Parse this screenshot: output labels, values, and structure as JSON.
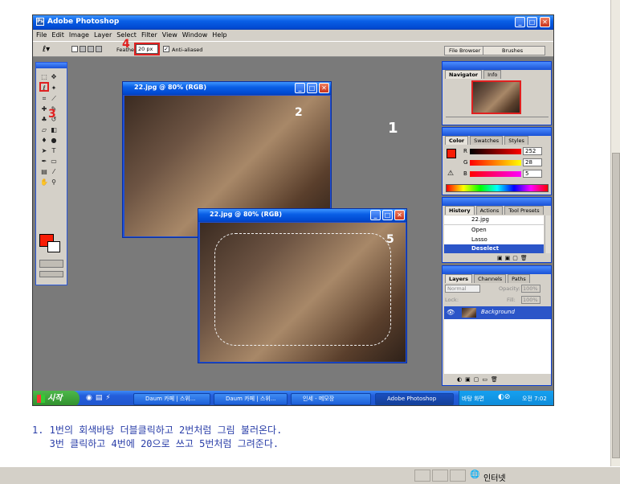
{
  "app": {
    "title": "Adobe Photoshop",
    "menu": [
      "File",
      "Edit",
      "Image",
      "Layer",
      "Select",
      "Filter",
      "View",
      "Window",
      "Help"
    ]
  },
  "options": {
    "feather_label": "Feather:",
    "feather_value": "20 px",
    "antialias_label": "Anti-aliased",
    "antialias_checked": true,
    "well_tabs": [
      "File Browser",
      "Brushes"
    ]
  },
  "annotations": {
    "a1": "1",
    "a2": "2",
    "a3": "3",
    "a4": "4",
    "a5": "5",
    "color": "#e02020"
  },
  "doc1": {
    "title": "22.jpg @ 80% (RGB)"
  },
  "doc2": {
    "title": "22.jpg @ 80% (RGB)"
  },
  "navigator": {
    "tabs": [
      "Navigator",
      "Info"
    ]
  },
  "color_panel": {
    "tabs": [
      "Color",
      "Swatches",
      "Styles"
    ],
    "channels": [
      {
        "label": "R",
        "value": "252"
      },
      {
        "label": "G",
        "value": "28"
      },
      {
        "label": "B",
        "value": "5"
      }
    ]
  },
  "history": {
    "tabs": [
      "History",
      "Actions",
      "Tool Presets"
    ],
    "items": [
      "22.jpg",
      "Open",
      "Lasso",
      "Deselect"
    ]
  },
  "layers": {
    "tabs": [
      "Layers",
      "Channels",
      "Paths"
    ],
    "blend_mode": "Normal",
    "opacity_label": "Opacity:",
    "opacity_value": "100%",
    "lock_label": "Lock:",
    "fill_label": "Fill:",
    "fill_value": "100%",
    "layer_name": "Background"
  },
  "taskbar": {
    "start_label": "시작",
    "buttons": [
      "Daum 카페 | 스위...",
      "Daum 카페 | 스위...",
      "인세 - 메모장",
      "Adobe Photoshop"
    ],
    "tray_label": "바탕 화면",
    "clock": "오전 7:02"
  },
  "caption": {
    "line1": "1. 1번의 회색바탕 더블클릭하고 2번처럼 그림 불러온다.",
    "line2": "   3번 클릭하고 4번에 20으로 쓰고 5번처럼 그려준다."
  },
  "statusbar": {
    "zone_label": "인터넷"
  }
}
